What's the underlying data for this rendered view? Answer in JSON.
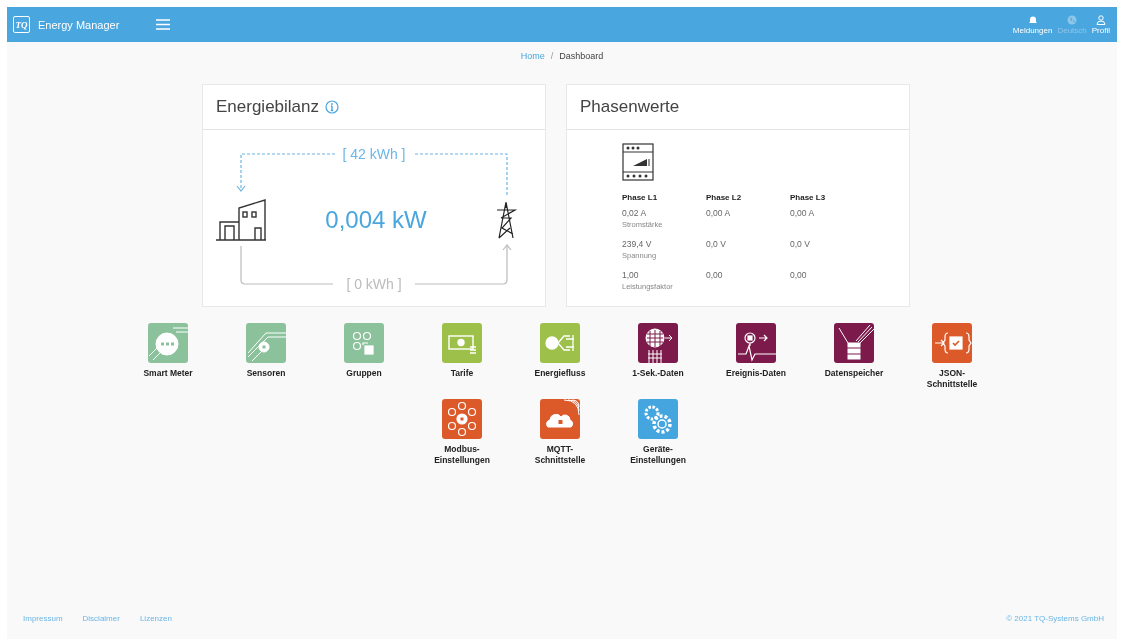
{
  "header": {
    "logo_text": "TQ",
    "title": "Energy Manager",
    "actions": [
      {
        "kind": "bell",
        "label": "Meldungen",
        "disabled": false
      },
      {
        "kind": "globe",
        "label": "Deutsch",
        "disabled": true
      },
      {
        "kind": "user",
        "label": "Profil",
        "disabled": false
      }
    ]
  },
  "breadcrumb": {
    "link": "Home",
    "separator": "/",
    "current": "Dashboard"
  },
  "balance": {
    "title": "Energiebilanz",
    "import": "[ 42 kWh ]",
    "power": "0,004 kW",
    "export": "[ 0 kWh ]"
  },
  "phases": {
    "title": "Phasenwerte",
    "columns": [
      "Phase L1",
      "Phase L2",
      "Phase L3"
    ],
    "rows": [
      {
        "label": "Stromstärke",
        "values": [
          "0,02 A",
          "0,00 A",
          "0,00 A"
        ]
      },
      {
        "label": "Spannung",
        "values": [
          "239,4 V",
          "0,0 V",
          "0,0 V"
        ]
      },
      {
        "label": "Leistungsfaktor",
        "values": [
          "1,00",
          "0,00",
          "0,00"
        ]
      }
    ]
  },
  "tiles": [
    [
      {
        "kind": "meter",
        "label": "Smart Meter",
        "color": "#8cc29b"
      },
      {
        "kind": "sensor",
        "label": "Sensoren",
        "color": "#8cc29b"
      },
      {
        "kind": "group",
        "label": "Gruppen",
        "color": "#8cc29b"
      },
      {
        "kind": "tariff",
        "label": "Tarife",
        "color": "#9dc04a"
      },
      {
        "kind": "flow",
        "label": "Energiefluss",
        "color": "#9dc04a"
      },
      {
        "kind": "seconds",
        "label": "1-Sek.-Daten",
        "color": "#7b1a4b"
      },
      {
        "kind": "event",
        "label": "Ereignis-Daten",
        "color": "#7b1a4b"
      },
      {
        "kind": "storage",
        "label": "Datenspeicher",
        "color": "#7b1a4b"
      },
      {
        "kind": "json",
        "label": "JSON-\nSchnittstelle",
        "color": "#dc5a2a"
      }
    ],
    [
      {
        "kind": "modbus",
        "label": "Modbus-\nEinstellungen",
        "color": "#dc5a2a"
      },
      {
        "kind": "mqtt",
        "label": "MQTT-\nSchnittstelle",
        "color": "#dc5a2a"
      },
      {
        "kind": "settings",
        "label": "Geräte-\nEinstellungen",
        "color": "#45a6df"
      }
    ]
  ],
  "footer": {
    "links": [
      "Impressum",
      "Disclaimer",
      "Lizenzen"
    ],
    "copyright": "© 2021 TQ-Systems GmbH"
  }
}
